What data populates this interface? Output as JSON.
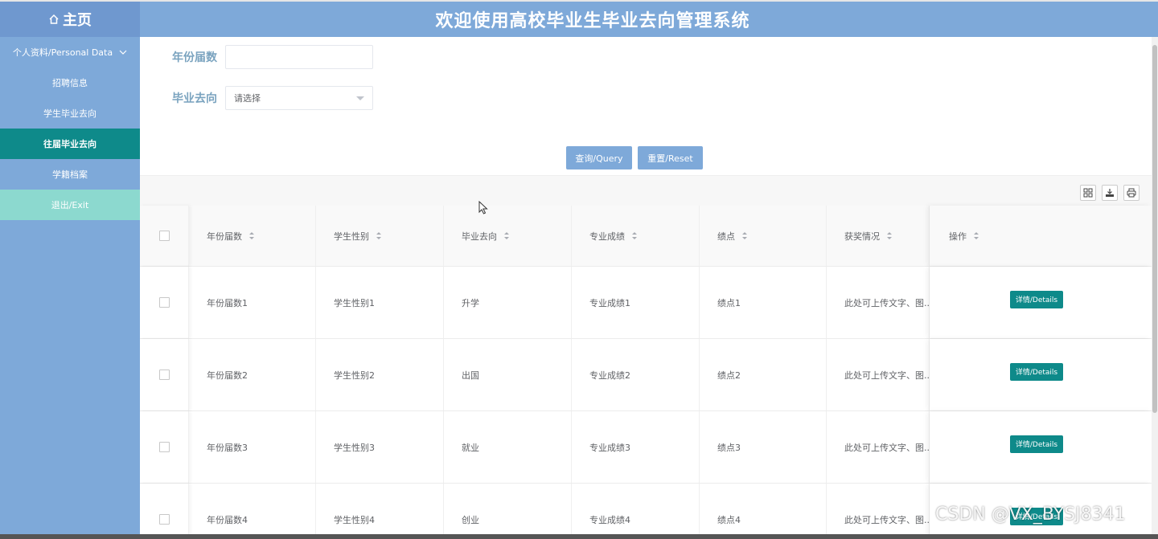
{
  "header": {
    "home_label": "主页",
    "title": "欢迎使用高校毕业生毕业去向管理系统"
  },
  "sidebar": {
    "items": [
      {
        "label": "个人资料/Personal Data",
        "state": "dropdown"
      },
      {
        "label": "招聘信息",
        "state": "normal"
      },
      {
        "label": "学生毕业去向",
        "state": "normal"
      },
      {
        "label": "往届毕业去向",
        "state": "active"
      },
      {
        "label": "学籍档案",
        "state": "normal"
      },
      {
        "label": "退出/Exit",
        "state": "exit"
      }
    ]
  },
  "search": {
    "year_label": "年份届数",
    "year_value": "",
    "destination_label": "毕业去向",
    "destination_placeholder": "请选择",
    "query_button": "查询/Query",
    "reset_button": "重置/Reset"
  },
  "table": {
    "columns": [
      "年份届数",
      "学生性别",
      "毕业去向",
      "专业成绩",
      "绩点",
      "获奖情况",
      "操作"
    ],
    "rows": [
      {
        "year": "年份届数1",
        "gender": "学生性别1",
        "destination": "升学",
        "score": "专业成绩1",
        "gpa": "绩点1",
        "awards": "此处可上传文字、图...",
        "action": "详情/Details"
      },
      {
        "year": "年份届数2",
        "gender": "学生性别2",
        "destination": "出国",
        "score": "专业成绩2",
        "gpa": "绩点2",
        "awards": "此处可上传文字、图...",
        "action": "详情/Details"
      },
      {
        "year": "年份届数3",
        "gender": "学生性别3",
        "destination": "就业",
        "score": "专业成绩3",
        "gpa": "绩点3",
        "awards": "此处可上传文字、图...",
        "action": "详情/Details"
      },
      {
        "year": "年份届数4",
        "gender": "学生性别4",
        "destination": "创业",
        "score": "专业成绩4",
        "gpa": "绩点4",
        "awards": "此处可上传文字、图...",
        "action": "详情/Details"
      }
    ]
  },
  "toolbar_icons": [
    "columns-icon",
    "export-icon",
    "print-icon"
  ],
  "watermark": "CSDN @VX_BYSJ8341",
  "colors": {
    "primary": "#7ea9d9",
    "active": "#0e8a8a",
    "exit": "#8cd9cf",
    "label": "#7aa3bf"
  }
}
